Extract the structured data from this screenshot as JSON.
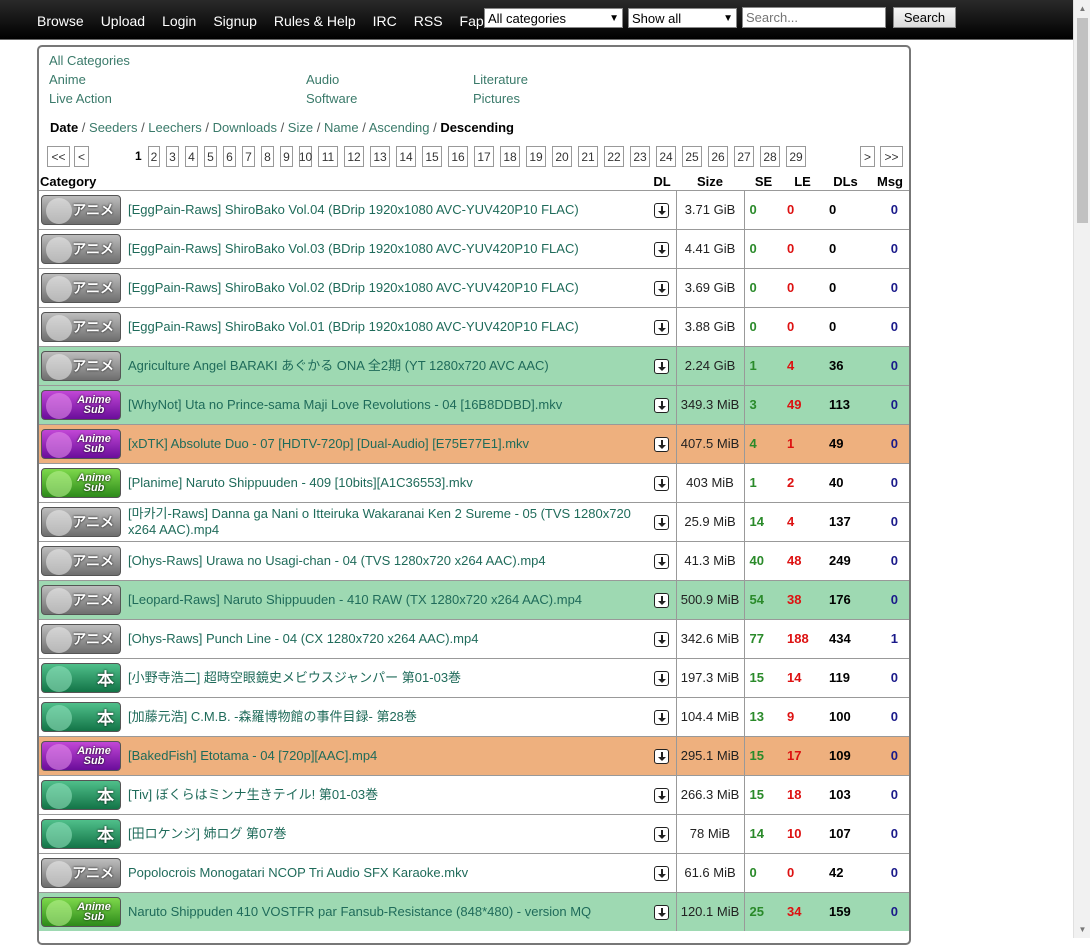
{
  "nav": {
    "items": [
      "Browse",
      "Upload",
      "Login",
      "Signup",
      "Rules & Help",
      "IRC",
      "RSS",
      "Fap"
    ],
    "category_select": "All categories",
    "filter_select": "Show all",
    "search_placeholder": "Search...",
    "search_button": "Search"
  },
  "categories": {
    "all": "All Categories",
    "anime": "Anime",
    "audio": "Audio",
    "literature": "Literature",
    "live_action": "Live Action",
    "software": "Software",
    "pictures": "Pictures"
  },
  "sort": {
    "date": "Date",
    "seeders": "Seeders",
    "leechers": "Leechers",
    "downloads": "Downloads",
    "size": "Size",
    "name": "Name",
    "ascending": "Ascending",
    "descending": "Descending"
  },
  "pager": {
    "first": "<<",
    "prev": "<",
    "current": "1",
    "pages": [
      "2",
      "3",
      "4",
      "5",
      "6",
      "7",
      "8",
      "9",
      "10",
      "11",
      "12",
      "13",
      "14",
      "15",
      "16",
      "17",
      "18",
      "19",
      "20",
      "21",
      "22",
      "23",
      "24",
      "25",
      "26",
      "27",
      "28",
      "29"
    ],
    "next": ">",
    "last": ">>"
  },
  "table": {
    "headers": {
      "category": "Category",
      "dl": "DL",
      "size": "Size",
      "se": "SE",
      "le": "LE",
      "dls": "DLs",
      "msg": "Msg"
    },
    "rows": [
      {
        "cat": "raw",
        "badge": "アニメ",
        "name": "[EggPain-Raws] ShiroBako Vol.04 (BDrip 1920x1080 AVC-YUV420P10 FLAC)",
        "size": "3.71 GiB",
        "se": "0",
        "le": "0",
        "dls": "0",
        "msg": "0",
        "row": "plain"
      },
      {
        "cat": "raw",
        "badge": "アニメ",
        "name": "[EggPain-Raws] ShiroBako Vol.03 (BDrip 1920x1080 AVC-YUV420P10 FLAC)",
        "size": "4.41 GiB",
        "se": "0",
        "le": "0",
        "dls": "0",
        "msg": "0",
        "row": "plain"
      },
      {
        "cat": "raw",
        "badge": "アニメ",
        "name": "[EggPain-Raws] ShiroBako Vol.02 (BDrip 1920x1080 AVC-YUV420P10 FLAC)",
        "size": "3.69 GiB",
        "se": "0",
        "le": "0",
        "dls": "0",
        "msg": "0",
        "row": "plain"
      },
      {
        "cat": "raw",
        "badge": "アニメ",
        "name": "[EggPain-Raws] ShiroBako Vol.01 (BDrip 1920x1080 AVC-YUV420P10 FLAC)",
        "size": "3.88 GiB",
        "se": "0",
        "le": "0",
        "dls": "0",
        "msg": "0",
        "row": "plain"
      },
      {
        "cat": "raw",
        "badge": "アニメ",
        "name": "Agriculture Angel BARAKI あぐかる ONA 全2期 (YT 1280x720 AVC AAC)",
        "size": "2.24 GiB",
        "se": "1",
        "le": "4",
        "dls": "36",
        "msg": "0",
        "row": "green"
      },
      {
        "cat": "sub",
        "badge": "Anime Sub",
        "name": "[WhyNot] Uta no Prince-sama Maji Love Revolutions - 04 [16B8DDBD].mkv",
        "size": "349.3 MiB",
        "se": "3",
        "le": "49",
        "dls": "113",
        "msg": "0",
        "row": "green"
      },
      {
        "cat": "sub",
        "badge": "Anime Sub",
        "name": "[xDTK] Absolute Duo - 07 [HDTV-720p] [Dual-Audio] [E75E77E1].mkv",
        "size": "407.5 MiB",
        "se": "4",
        "le": "1",
        "dls": "49",
        "msg": "0",
        "row": "orange"
      },
      {
        "cat": "subg",
        "badge": "Anime Sub",
        "name": "[Planime] Naruto Shippuuden - 409 [10bits][A1C36553].mkv",
        "size": "403 MiB",
        "se": "1",
        "le": "2",
        "dls": "40",
        "msg": "0",
        "row": "plain"
      },
      {
        "cat": "raw",
        "badge": "アニメ",
        "name": "[마카기-Raws] Danna ga Nani o Itteiruka Wakaranai Ken 2 Sureme - 05 (TVS 1280x720 x264 AAC).mp4",
        "size": "25.9 MiB",
        "se": "14",
        "le": "4",
        "dls": "137",
        "msg": "0",
        "row": "plain"
      },
      {
        "cat": "raw",
        "badge": "アニメ",
        "name": "[Ohys-Raws] Urawa no Usagi-chan - 04 (TVS 1280x720 x264 AAC).mp4",
        "size": "41.3 MiB",
        "se": "40",
        "le": "48",
        "dls": "249",
        "msg": "0",
        "row": "plain"
      },
      {
        "cat": "raw",
        "badge": "アニメ",
        "name": "[Leopard-Raws] Naruto Shippuuden - 410 RAW (TX 1280x720 x264 AAC).mp4",
        "size": "500.9 MiB",
        "se": "54",
        "le": "38",
        "dls": "176",
        "msg": "0",
        "row": "green"
      },
      {
        "cat": "raw",
        "badge": "アニメ",
        "name": "[Ohys-Raws] Punch Line - 04 (CX 1280x720 x264 AAC).mp4",
        "size": "342.6 MiB",
        "se": "77",
        "le": "188",
        "dls": "434",
        "msg": "1",
        "row": "plain"
      },
      {
        "cat": "lit",
        "badge": "本",
        "name": "[小野寺浩二] 超時空眼鏡史メビウスジャンパー 第01-03巻",
        "size": "197.3 MiB",
        "se": "15",
        "le": "14",
        "dls": "119",
        "msg": "0",
        "row": "plain"
      },
      {
        "cat": "lit",
        "badge": "本",
        "name": "[加藤元浩] C.M.B. -森羅博物館の事件目録- 第28巻",
        "size": "104.4 MiB",
        "se": "13",
        "le": "9",
        "dls": "100",
        "msg": "0",
        "row": "plain"
      },
      {
        "cat": "sub",
        "badge": "Anime Sub",
        "name": "[BakedFish] Etotama - 04 [720p][AAC].mp4",
        "size": "295.1 MiB",
        "se": "15",
        "le": "17",
        "dls": "109",
        "msg": "0",
        "row": "orange"
      },
      {
        "cat": "lit",
        "badge": "本",
        "name": "[Tiv] ぼくらはミンナ生きテイル! 第01-03巻",
        "size": "266.3 MiB",
        "se": "15",
        "le": "18",
        "dls": "103",
        "msg": "0",
        "row": "plain"
      },
      {
        "cat": "lit",
        "badge": "本",
        "name": "[田ロケンジ] 姉ログ 第07巻",
        "size": "78 MiB",
        "se": "14",
        "le": "10",
        "dls": "107",
        "msg": "0",
        "row": "plain"
      },
      {
        "cat": "raw",
        "badge": "アニメ",
        "name": "Popolocrois Monogatari NCOP Tri Audio SFX Karaoke.mkv",
        "size": "61.6 MiB",
        "se": "0",
        "le": "0",
        "dls": "42",
        "msg": "0",
        "row": "plain"
      },
      {
        "cat": "subg",
        "badge": "Anime Sub",
        "name": "Naruto Shippuden 410 VOSTFR par Fansub-Resistance (848*480) - version MQ",
        "size": "120.1 MiB",
        "se": "25",
        "le": "34",
        "dls": "159",
        "msg": "0",
        "row": "green"
      }
    ]
  },
  "colors": {
    "link": "#1f6b5a",
    "row_green": "#9ed9b2",
    "row_orange": "#eeb07e",
    "seeders": "#2a8a2a",
    "leechers": "#dd1111",
    "msg": "#1a1a8a"
  }
}
